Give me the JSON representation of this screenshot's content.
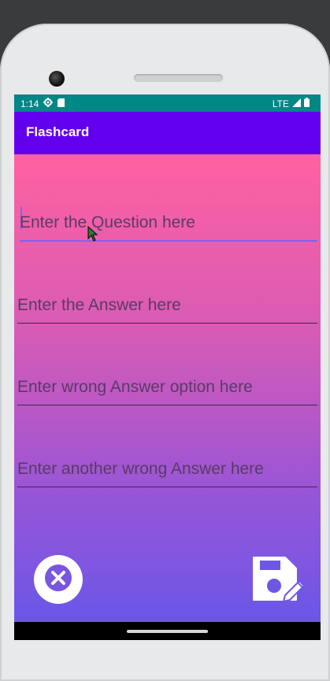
{
  "status_bar": {
    "time": "1:14",
    "network": "LTE"
  },
  "app_bar": {
    "title": "Flashcard"
  },
  "fields": {
    "question": {
      "placeholder": "Enter the Question here",
      "value": ""
    },
    "answer": {
      "placeholder": "Enter the Answer here",
      "value": ""
    },
    "wrong_answer": {
      "placeholder": "Enter wrong Answer option here",
      "value": ""
    },
    "another_wrong_answer": {
      "placeholder": "Enter another wrong Answer here",
      "value": ""
    }
  },
  "icons": {
    "cancel": "close-icon",
    "save": "save-edit-icon",
    "settings_status": "gear-icon",
    "sd_status": "sd-card-icon",
    "signal": "signal-icon",
    "battery": "battery-icon"
  },
  "colors": {
    "status_bar": "#018786",
    "app_bar": "#6200ee",
    "gradient_top": "#ff61a0",
    "gradient_bottom": "#6b56e8",
    "accent": "#7e64ee"
  }
}
